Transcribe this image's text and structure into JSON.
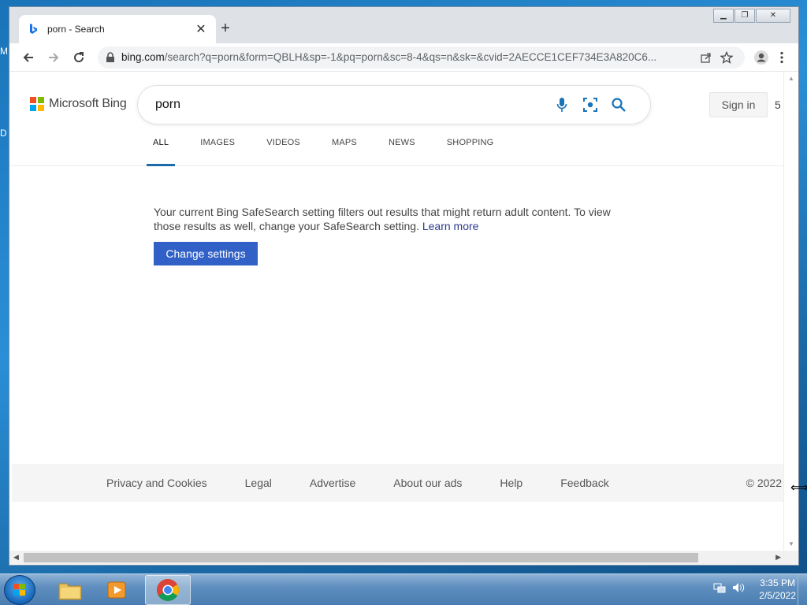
{
  "desktop": {
    "glyph_top": "M",
    "glyph_mid": "D"
  },
  "tab": {
    "title": "porn - Search",
    "close": "✕",
    "new": "+"
  },
  "window_buttons": {
    "min": "▁",
    "max": "❐",
    "close": "✕"
  },
  "address": {
    "host": "bing.com",
    "path": "/search?q=porn&form=QBLH&sp=-1&pq=porn&sc=8-4&qs=n&sk=&cvid=2AECCE1CEF734E3A820C6..."
  },
  "bing": {
    "brand": "Microsoft Bing",
    "query": "porn",
    "signin": "Sign in",
    "rewards": "5",
    "scopes": [
      "ALL",
      "IMAGES",
      "VIDEOS",
      "MAPS",
      "NEWS",
      "SHOPPING"
    ],
    "notice": "Your current Bing SafeSearch setting filters out results that might return adult content. To view those results as well, change your SafeSearch setting.",
    "learn_more": "Learn more",
    "change_settings": "Change settings",
    "footer_links": [
      "Privacy and Cookies",
      "Legal",
      "Advertise",
      "About our ads",
      "Help",
      "Feedback"
    ],
    "copyright": "© 2022"
  },
  "taskbar": {
    "time": "3:35 PM",
    "date": "2/5/2022"
  },
  "colors": {
    "accent": "#3160c6",
    "scope_underline": "#1d6aa8",
    "ms_red": "#f25022",
    "ms_green": "#7fba00",
    "ms_blue": "#00a4ef",
    "ms_yellow": "#ffb900"
  }
}
